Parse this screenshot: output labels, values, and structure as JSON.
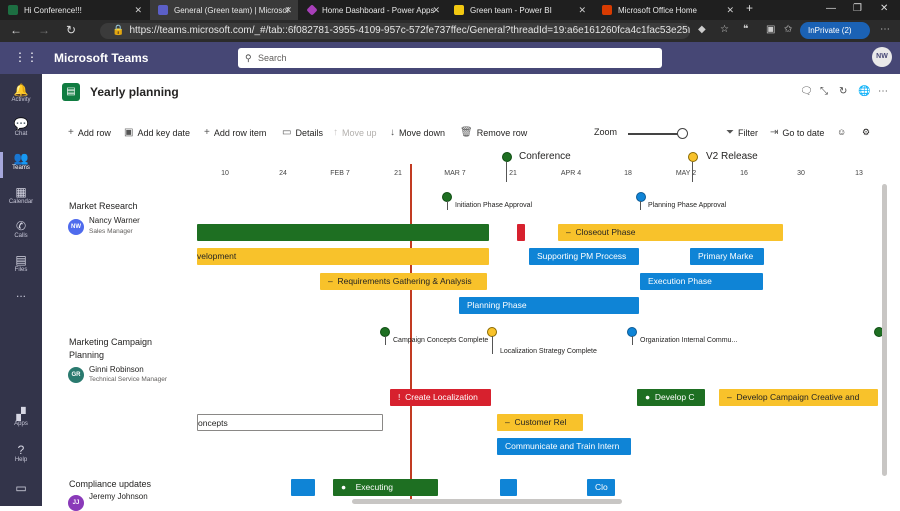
{
  "browser": {
    "tabs": [
      {
        "label": "Hi Conference!!!",
        "icon": "excel-icon",
        "color": "#1d6f42"
      },
      {
        "label": "General (Green team) | Microsof",
        "icon": "teams-icon",
        "color": "#5b5fc7"
      },
      {
        "label": "Home Dashboard - Power Apps",
        "icon": "powerapps-icon",
        "color": "#a83fb9"
      },
      {
        "label": "Green team - Power BI",
        "icon": "powerbi-icon",
        "color": "#f2c811"
      },
      {
        "label": "Microsoft Office Home",
        "icon": "office-icon",
        "color": "#d83b01"
      }
    ],
    "new_tab": "+",
    "url": "https://teams.microsoft.com/_#/tab::6f082781-3955-4109-957c-572fe737ffec/General?threadId=19:a6e161260fca4c1fac53e25fa9d...",
    "inprivate": "InPrivate (2)"
  },
  "teams": {
    "app_title": "Microsoft Teams",
    "search_placeholder": "Search",
    "user_initials": "NW",
    "rail": [
      {
        "label": "Activity",
        "icon": "bell-icon"
      },
      {
        "label": "Chat",
        "icon": "chat-icon"
      },
      {
        "label": "Teams",
        "icon": "teams-icon"
      },
      {
        "label": "Calendar",
        "icon": "calendar-icon"
      },
      {
        "label": "Calls",
        "icon": "phone-icon"
      },
      {
        "label": "Files",
        "icon": "file-icon"
      },
      {
        "label": "...",
        "icon": "more-icon"
      },
      {
        "label": "Apps",
        "icon": "apps-icon"
      },
      {
        "label": "Help",
        "icon": "help-icon"
      }
    ]
  },
  "page": {
    "title": "Yearly planning",
    "toolbar": {
      "add_row": "Add row",
      "add_key_date": "Add key date",
      "add_row_item": "Add row item",
      "details": "Details",
      "move_up": "Move up",
      "move_down": "Move down",
      "remove_row": "Remove row",
      "zoom_label": "Zoom",
      "zoom_level": 0.95,
      "filter": "Filter",
      "go_to_date": "Go to date"
    }
  },
  "timeline": {
    "key_dates": [
      {
        "label": "Conference",
        "color": "#1e6f22"
      },
      {
        "label": "V2 Release",
        "color": "#f8c22b"
      }
    ],
    "ticks": [
      "10",
      "24",
      "FEB 7",
      "21",
      "MAR 7",
      "21",
      "APR 4",
      "18",
      "MAY 2",
      "16",
      "30",
      "13"
    ],
    "rows": [
      {
        "title": "Market Research",
        "person": "Nancy Warner",
        "initials": "NW",
        "role": "Sales Manager",
        "avatar_color": "#4f6bed",
        "milestones": [
          "Initiation Phase Approval",
          "Planning Phase Approval"
        ],
        "bars": [
          "",
          "",
          "Closeout Phase",
          "velopment",
          "Supporting PM Process",
          "Primary Marke",
          "Requirements Gathering & Analysis",
          "Execution Phase",
          "Planning Phase"
        ]
      },
      {
        "title": "Marketing Campaign Planning",
        "person": "Ginni Robinson",
        "initials": "GR",
        "role": "Technical Service Manager",
        "avatar_color": "#2a7a6f",
        "milestones": [
          "Campaign Concepts Complete",
          "Localization Strategy Complete",
          "Organization Internal Commu..."
        ],
        "bars": [
          "Create Localization",
          "Develop C",
          "Develop Campaign Creative and",
          "oncepts",
          "Customer Rel",
          "Communicate and Train Intern"
        ]
      },
      {
        "title": "Compliance updates",
        "person": "Jeremy Johnson",
        "initials": "JJ",
        "role": "",
        "avatar_color": "#8a3ab9",
        "bars": [
          "Executing",
          "Clo"
        ]
      }
    ]
  }
}
